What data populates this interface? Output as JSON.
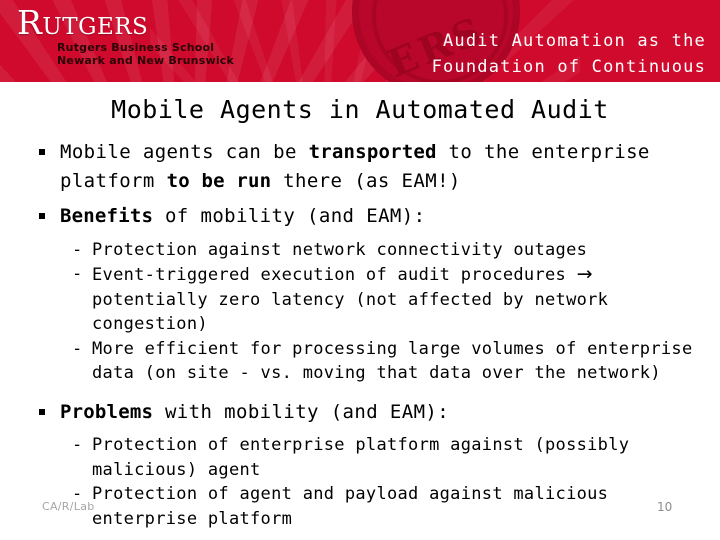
{
  "brand": {
    "wordmark": "Rutgers",
    "unit_line1": "Rutgers Business School",
    "unit_line2": "Newark and New Brunswick",
    "seal_text": "ERS",
    "band_color": "#cf0a2c",
    "accent_color": "#b8072a"
  },
  "header": {
    "title": "Audit Automation as the\nFoundation of Continuous"
  },
  "slide": {
    "title": "Mobile Agents in Automated Audit",
    "bullets": [
      {
        "level": 1,
        "parts": [
          {
            "text": "Mobile agents can be ",
            "bold": false
          },
          {
            "text": "transported",
            "bold": true
          },
          {
            "text": " to the enterprise platform ",
            "bold": false
          },
          {
            "text": "to be run",
            "bold": true
          },
          {
            "text": " there (as EAM!)",
            "bold": false
          }
        ]
      },
      {
        "level": 1,
        "parts": [
          {
            "text": "Benefits",
            "bold": true
          },
          {
            "text": " of mobility (and EAM):",
            "bold": false
          }
        ]
      },
      {
        "level": 2,
        "marker": "-",
        "parts": [
          {
            "text": "Protection against network connectivity outages",
            "bold": false
          }
        ]
      },
      {
        "level": 2,
        "marker": "-",
        "parts": [
          {
            "text": "Event-triggered execution of audit procedures ",
            "bold": false
          },
          {
            "text": "→",
            "bold": false,
            "arrow": true
          },
          {
            "text": " potentially zero latency (not affected by network congestion)",
            "bold": false
          }
        ]
      },
      {
        "level": 2,
        "marker": "-",
        "parts": [
          {
            "text": "More efficient for processing large volumes of enterprise data (on site - vs. moving that data over the network)",
            "bold": false
          }
        ]
      },
      {
        "level": 1,
        "parts": [
          {
            "text": "Problems",
            "bold": true
          },
          {
            "text": " with mobility (and EAM):",
            "bold": false
          }
        ]
      },
      {
        "level": 2,
        "marker": "-",
        "parts": [
          {
            "text": "Protection of enterprise platform against (possibly malicious) agent",
            "bold": false
          }
        ]
      },
      {
        "level": 2,
        "marker": "-",
        "parts": [
          {
            "text": "Protection of agent and payload against malicious enterprise platform",
            "bold": false
          }
        ]
      }
    ]
  },
  "footer": {
    "lab_label": "CA/R/Lab",
    "page_number": "10"
  }
}
